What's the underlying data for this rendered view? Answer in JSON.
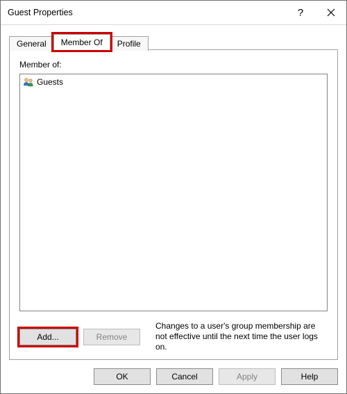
{
  "window": {
    "title": "Guest Properties"
  },
  "tabs": {
    "general": "General",
    "memberof": "Member Of",
    "profile": "Profile",
    "active": "memberof"
  },
  "panel": {
    "label": "Member of:",
    "items": [
      {
        "name": "Guests",
        "icon": "group-icon"
      }
    ],
    "add_label": "Add...",
    "remove_label": "Remove",
    "hint": "Changes to a user's group membership are not effective until the next time the user logs on."
  },
  "footer": {
    "ok": "OK",
    "cancel": "Cancel",
    "apply": "Apply",
    "help": "Help"
  },
  "highlight": {
    "tab_memberof": true,
    "add_button": true
  },
  "colors": {
    "highlight": "#cc0000"
  }
}
